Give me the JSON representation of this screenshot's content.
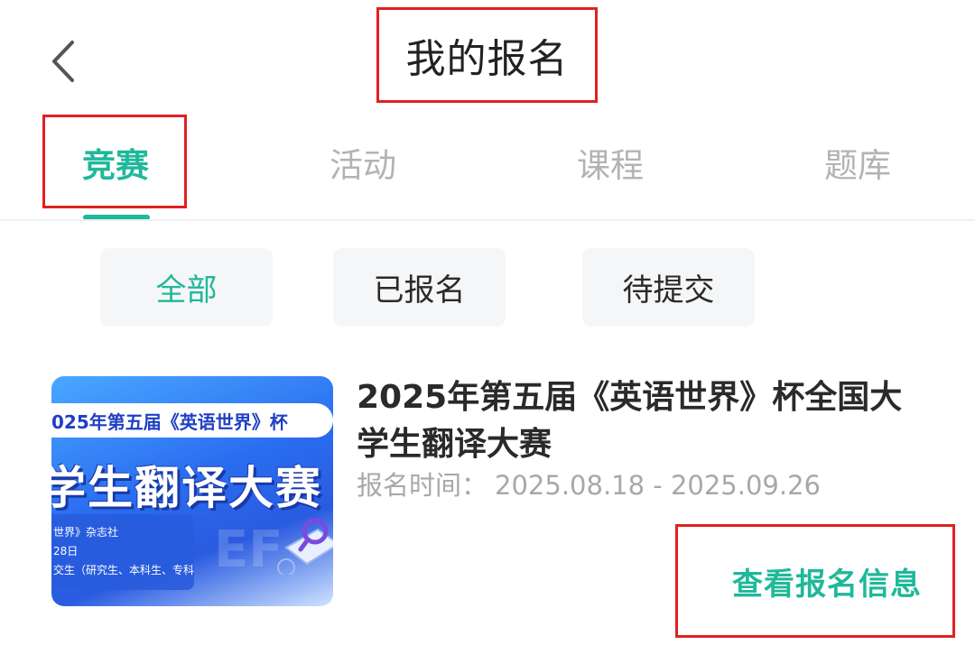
{
  "header": {
    "title": "我的报名",
    "back_icon": "chevron-left-icon"
  },
  "tabs": [
    {
      "label": "竞赛",
      "active": true
    },
    {
      "label": "活动",
      "active": false
    },
    {
      "label": "课程",
      "active": false
    },
    {
      "label": "题库",
      "active": false
    }
  ],
  "filters": [
    {
      "label": "全部",
      "active": true
    },
    {
      "label": "已报名",
      "active": false
    },
    {
      "label": "待提交",
      "active": false
    }
  ],
  "card": {
    "image": {
      "banner": "025年第五届《英语世界》杯",
      "headline": "学生翻译大赛",
      "info_lines": [
        "世界》杂志社",
        "28日",
        "交生（研究生、本科生、专科生）"
      ]
    },
    "title": "2025年第五届《英语世界》杯全国大学生翻译大赛",
    "time_label": "报名时间：",
    "time_value": "2025.08.18 - 2025.09.26",
    "action_label": "查看报名信息"
  },
  "colors": {
    "accent": "#1fb89a",
    "highlight_box": "#e0211f",
    "muted_text": "#a8a8a8",
    "chip_bg": "#f5f6f7"
  }
}
